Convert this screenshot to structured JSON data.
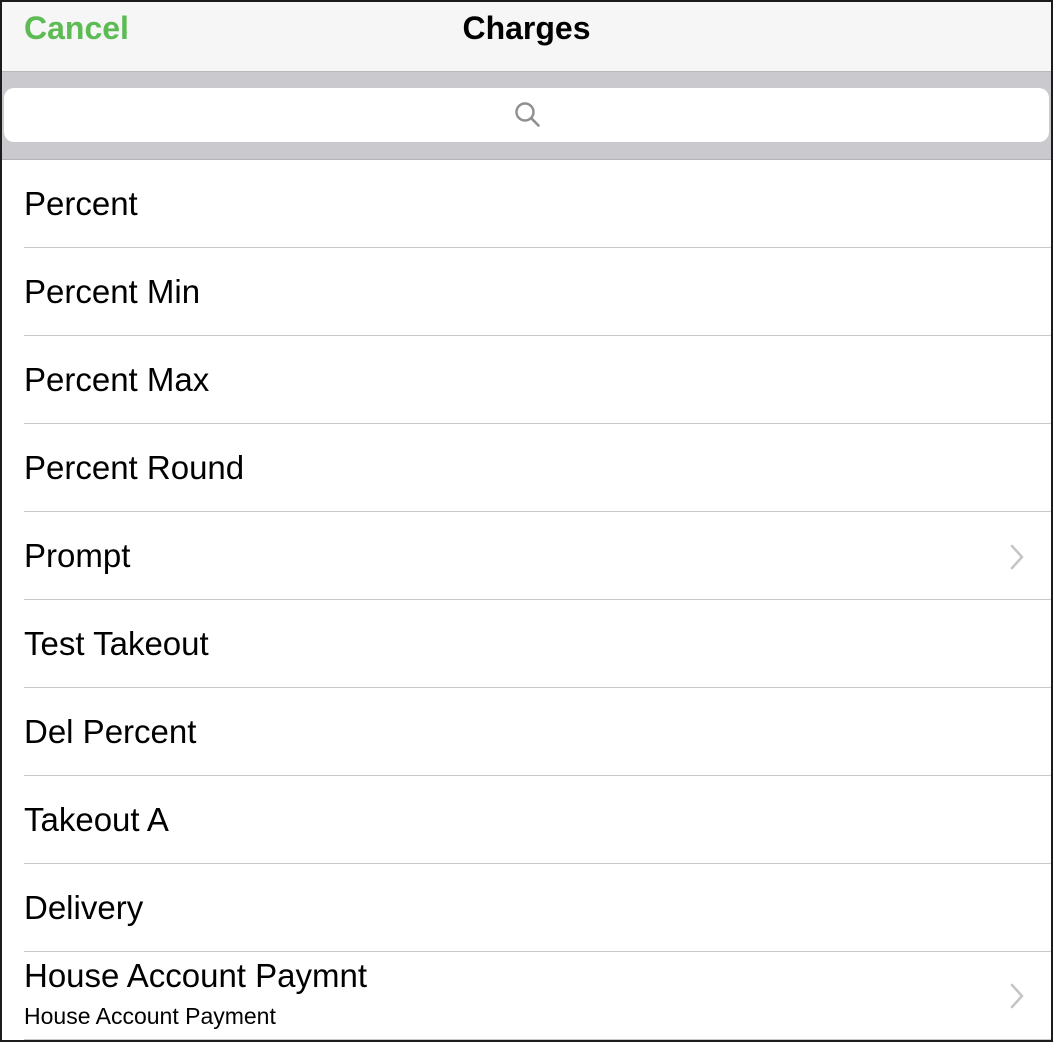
{
  "navbar": {
    "cancel_label": "Cancel",
    "title": "Charges",
    "accent_color": "#5dbb54"
  },
  "search": {
    "icon": "search-icon",
    "value": "",
    "placeholder": ""
  },
  "charges": [
    {
      "label": "Percent",
      "subtitle": "",
      "has_chevron": false
    },
    {
      "label": "Percent Min",
      "subtitle": "",
      "has_chevron": false
    },
    {
      "label": "Percent Max",
      "subtitle": "",
      "has_chevron": false
    },
    {
      "label": "Percent Round",
      "subtitle": "",
      "has_chevron": false
    },
    {
      "label": "Prompt",
      "subtitle": "",
      "has_chevron": true
    },
    {
      "label": "Test Takeout",
      "subtitle": "",
      "has_chevron": false
    },
    {
      "label": "Del Percent",
      "subtitle": "",
      "has_chevron": false
    },
    {
      "label": "Takeout A",
      "subtitle": "",
      "has_chevron": false
    },
    {
      "label": "Delivery",
      "subtitle": "",
      "has_chevron": false
    },
    {
      "label": "House Account Paymnt",
      "subtitle": "House Account Payment",
      "has_chevron": true
    }
  ]
}
